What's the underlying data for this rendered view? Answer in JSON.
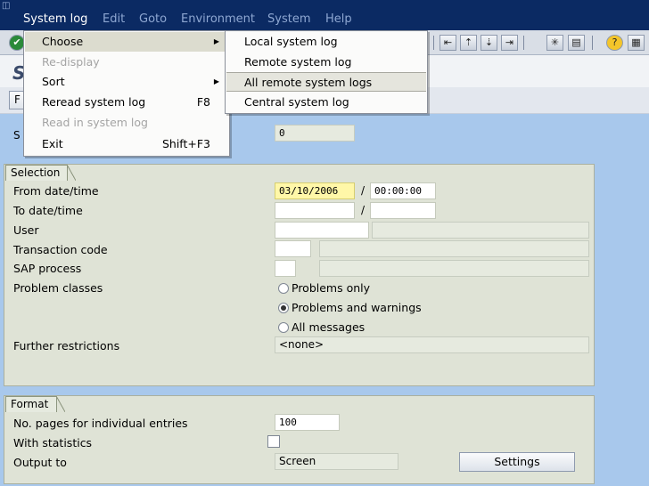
{
  "menubar": {
    "items": [
      {
        "label": "System log"
      },
      {
        "label": "Edit"
      },
      {
        "label": "Goto"
      },
      {
        "label": "Environment"
      },
      {
        "label": "System"
      },
      {
        "label": "Help"
      }
    ]
  },
  "page": {
    "title": "S",
    "app_button": "F"
  },
  "status": {
    "label": "S",
    "value": "0"
  },
  "selection": {
    "title": "Selection",
    "from_label": "From date/time",
    "from_date": "03/10/2006",
    "from_time": "00:00:00",
    "to_label": "To date/time",
    "to_date": "",
    "to_time": "",
    "user_label": "User",
    "user_value": "",
    "tcode_label": "Transaction code",
    "tcode_value": "",
    "sap_process_label": "SAP process",
    "sap_process_value": "",
    "problem_classes_label": "Problem classes",
    "problem_options": [
      "Problems only",
      "Problems and warnings",
      "All messages"
    ],
    "problem_selected": "Problems and warnings",
    "restrictions_label": "Further restrictions",
    "restrictions_value": "<none>"
  },
  "format": {
    "title": "Format",
    "pages_label": "No. pages for individual entries",
    "pages_value": "100",
    "stats_label": "With statistics",
    "stats_checked": false,
    "output_label": "Output to",
    "output_value": "Screen",
    "settings_button": "Settings"
  },
  "dropdown": {
    "items": [
      {
        "label": "Choose",
        "accel": "",
        "submenu": true,
        "disabled": false
      },
      {
        "label": "Re-display",
        "accel": "",
        "submenu": false,
        "disabled": true
      },
      {
        "label": "Sort",
        "accel": "",
        "submenu": true,
        "disabled": false
      },
      {
        "label": "Reread system log",
        "accel": "F8",
        "submenu": false,
        "disabled": false
      },
      {
        "label": "Read in system log",
        "accel": "",
        "submenu": false,
        "disabled": true
      },
      {
        "label": "Exit",
        "accel": "Shift+F3",
        "submenu": false,
        "disabled": false
      }
    ]
  },
  "submenu": {
    "items": [
      {
        "label": "Local system log"
      },
      {
        "label": "Remote system log"
      },
      {
        "label": "All remote system logs"
      },
      {
        "label": "Central system log"
      }
    ]
  },
  "colors": {
    "menubar_bg": "#0b2a63",
    "workarea_bg": "#a8c8ec",
    "group_bg": "#dfe3d6",
    "highlight_field": "#fff7a8"
  }
}
